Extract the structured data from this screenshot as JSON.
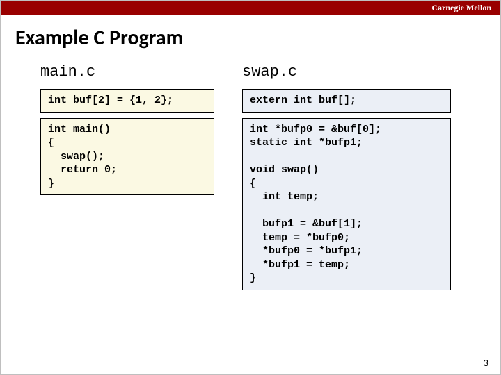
{
  "header": {
    "brand": "Carnegie Mellon"
  },
  "title": "Example C Program",
  "left": {
    "filename": "main.c",
    "code_decl": "int buf[2] = {1, 2};",
    "code_main": "int main()\n{\n  swap();\n  return 0;\n}"
  },
  "right": {
    "filename": "swap.c",
    "code_extern": "extern int buf[];",
    "code_swap": "int *bufp0 = &buf[0];\nstatic int *bufp1;\n\nvoid swap()\n{\n  int temp;\n\n  bufp1 = &buf[1];\n  temp = *bufp0;\n  *bufp0 = *bufp1;\n  *bufp1 = temp;\n}"
  },
  "page_number": "3"
}
